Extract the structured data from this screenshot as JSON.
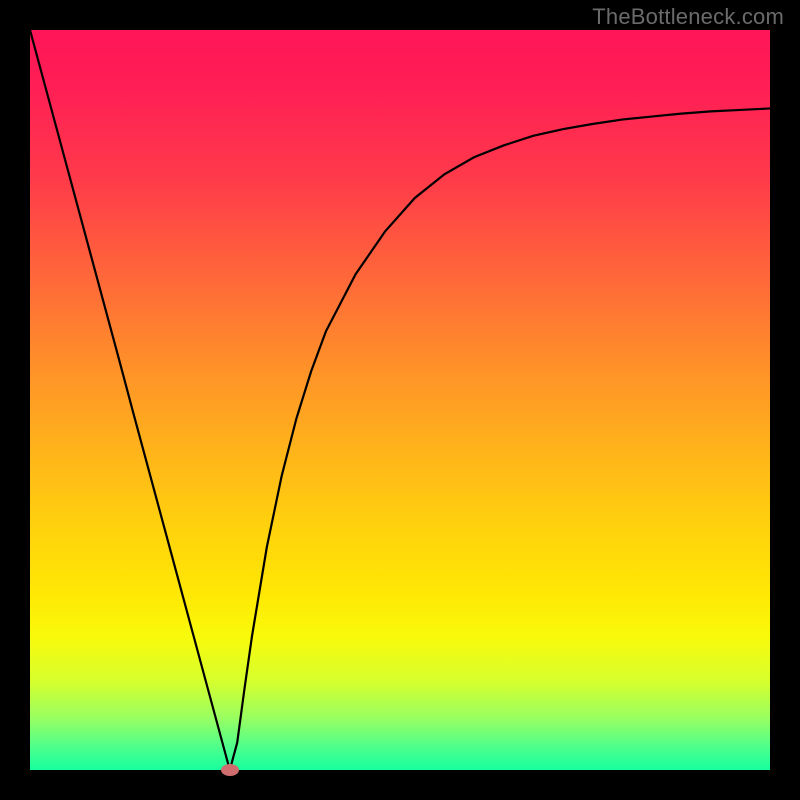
{
  "watermark": {
    "text": "TheBottleneck.com"
  },
  "chart_data": {
    "type": "line",
    "title": "",
    "xlabel": "",
    "ylabel": "",
    "xlim": [
      0,
      100
    ],
    "ylim": [
      0,
      100
    ],
    "grid": false,
    "legend": false,
    "series": [
      {
        "name": "curve",
        "x": [
          0,
          2,
          4,
          6,
          8,
          10,
          12,
          14,
          16,
          18,
          20,
          22,
          24,
          26,
          27,
          28,
          29,
          30,
          32,
          34,
          36,
          38,
          40,
          44,
          48,
          52,
          56,
          60,
          64,
          68,
          72,
          76,
          80,
          84,
          88,
          92,
          96,
          100
        ],
        "y": [
          100,
          92.6,
          85.2,
          77.8,
          70.4,
          63.0,
          55.6,
          48.1,
          40.7,
          33.3,
          25.9,
          18.5,
          11.1,
          3.7,
          0.0,
          3.7,
          11.1,
          18.1,
          30.1,
          39.7,
          47.5,
          53.9,
          59.3,
          67.0,
          72.8,
          77.3,
          80.5,
          82.8,
          84.4,
          85.7,
          86.6,
          87.3,
          87.9,
          88.3,
          88.7,
          89.0,
          89.2,
          89.4
        ]
      }
    ],
    "marker": {
      "x": 27,
      "y": 0,
      "color": "#cf6d6e"
    }
  }
}
